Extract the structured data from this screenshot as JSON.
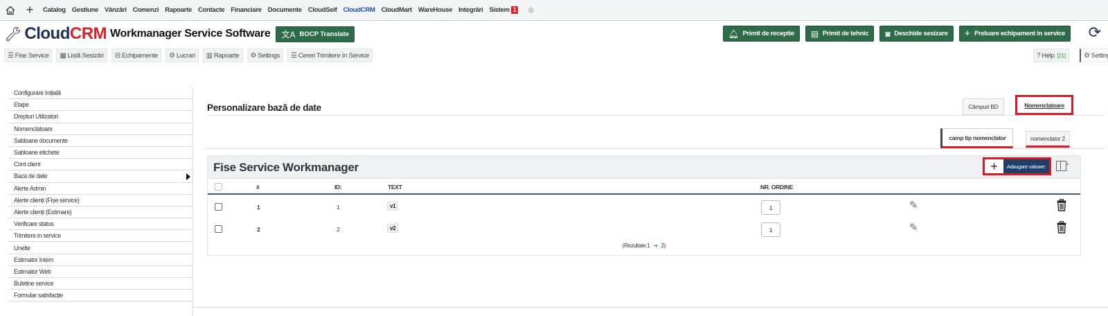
{
  "top_menu": {
    "items": [
      "Catalog",
      "Gestiune",
      "Vânzări",
      "Comenzi",
      "Rapoarte",
      "Contacte",
      "Financiare",
      "Documente",
      "CloudSeif",
      "CloudCRM",
      "CloudMart",
      "WareHouse",
      "Integrări",
      "Sistem"
    ],
    "active": "CloudCRM",
    "sistem_badge": "1"
  },
  "header": {
    "logo_cloud": "Cloud",
    "logo_crm": "CRM",
    "product": "Workmanager Service Software",
    "translate_btn": "BOCP Translate",
    "actions": [
      "Primit de receptie",
      "Primit de tehnic",
      "Deschide sesizare",
      "Preluare echipament in service"
    ]
  },
  "module_nav": {
    "items": [
      "Fise Service",
      "Listă Sesizări",
      "Echipamente",
      "Lucrari",
      "Rapoarte",
      "Settings",
      "Cereri Trimitere In Service"
    ],
    "help_label": "Help",
    "help_count": "[21]",
    "settings_label": "Settings"
  },
  "sidebar": {
    "items": [
      "Configurare Inițială",
      "Etape",
      "Drepturi Utilizatori",
      "Nomenclatoare",
      "Sabloane documente",
      "Sabloane etichete",
      "Cont client",
      "Baza de date",
      "Alerte Admin",
      "Alerte clienți (Fișe service)",
      "Alerte clienți (Estimare)",
      "Verificare status",
      "Trimitere in service",
      "Unelte",
      "Estimator Intern",
      "Estimator Web",
      "Buletine service",
      "Formular satisfacție"
    ],
    "active": "Baza de date"
  },
  "main": {
    "title": "Personalizare bază de date",
    "tabs": [
      "Câmpuri BD",
      "Nomenclatoare"
    ],
    "active_tab": "Nomenclatoare",
    "subtabs": [
      "camp tip nomenclator",
      "nomenclator 2"
    ],
    "active_subtab": "camp tip nomenclator"
  },
  "grid": {
    "title": "Fise Service Workmanager",
    "add_label": "Adaugare valoare:",
    "columns": [
      "#",
      "ID:",
      "TEXT",
      "NR. ORDINE"
    ],
    "rows": [
      {
        "num": "1",
        "id": "1",
        "text": "v1",
        "ordine": "1"
      },
      {
        "num": "2",
        "id": "2",
        "text": "v2",
        "ordine": "1"
      }
    ],
    "results_prefix": "(Rezultate:1",
    "results_suffix": "2)"
  },
  "icons": {
    "home": "home-icon",
    "plus": "plus-icon",
    "gear": "gear-icon",
    "wrench": "wrench-icon",
    "refresh": "refresh-icon",
    "pencil": "pencil-icon",
    "trash": "trash-icon"
  },
  "colors": {
    "brand_navy": "#1f2f5a",
    "brand_red": "#d6232a",
    "action_green": "#2e6b48",
    "highlight_red": "#d81b22",
    "add_blue": "#1e3f6a",
    "active_menu": "#1f4fa8"
  }
}
